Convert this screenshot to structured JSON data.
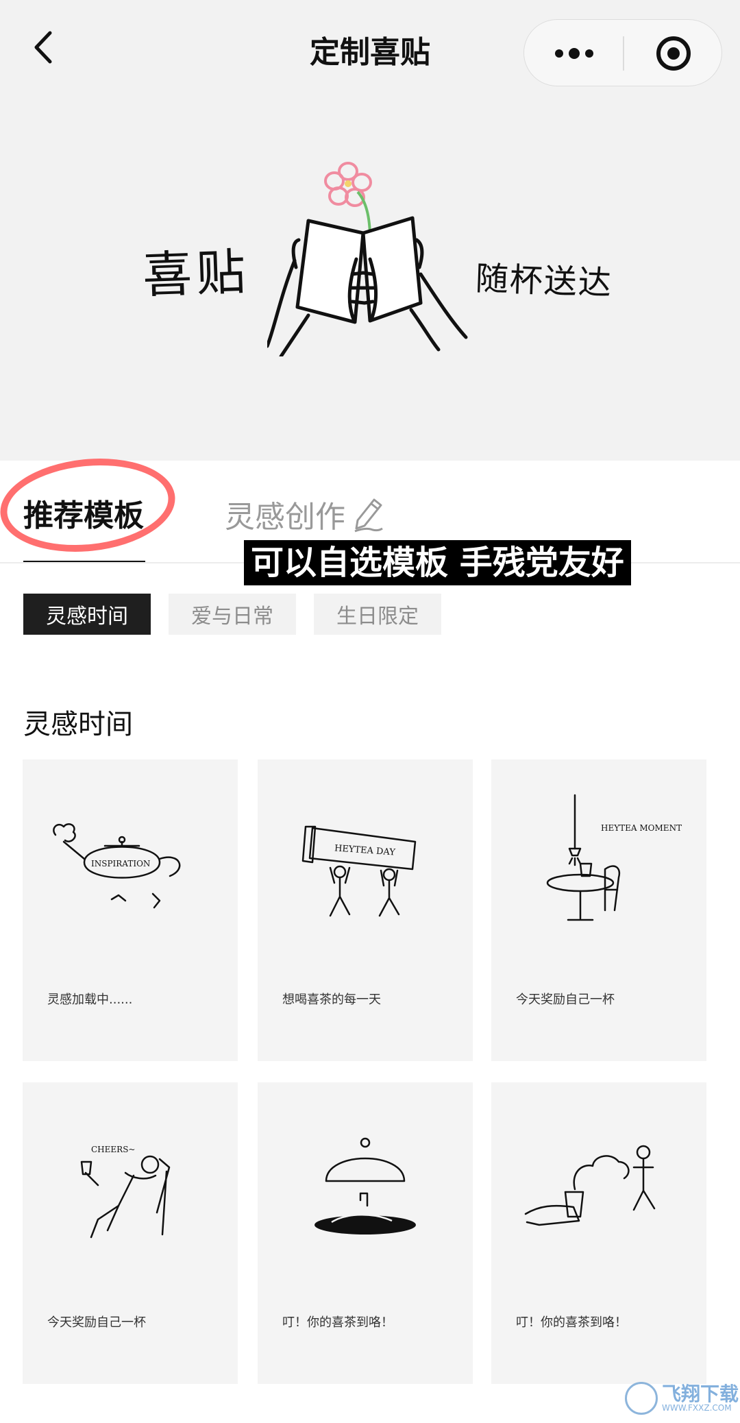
{
  "nav": {
    "title": "定制喜贴",
    "icons": {
      "back": "back-chevron-icon",
      "more": "more-dots-icon",
      "close": "target-circle-icon"
    }
  },
  "hero": {
    "left_text": "喜贴",
    "right_text": "随杯送达"
  },
  "tabs": {
    "recommended": "推荐模板",
    "inspiration": "灵感创作",
    "inspiration_icon": "pencil-icon"
  },
  "caption": "可以自选模板 手残党友好",
  "chips": [
    {
      "label": "灵感时间",
      "active": true
    },
    {
      "label": "爱与日常",
      "active": false
    },
    {
      "label": "生日限定",
      "active": false
    }
  ],
  "section_title": "灵感时间",
  "cards": [
    {
      "label": "灵感加载中......",
      "art_text": "INSPIRATION",
      "illustration": "teapot"
    },
    {
      "label": "想喝喜茶的每一天",
      "art_text": "HEYTEA DAY",
      "illustration": "cup-carriers"
    },
    {
      "label": "今天奖励自己一杯",
      "art_text": "HEYTEA MOMENT",
      "illustration": "table-lamp"
    },
    {
      "label": "今天奖励自己一杯",
      "art_text": "CHEERS~",
      "illustration": "lounging-man"
    },
    {
      "label": "叮！你的喜茶到咯！",
      "art_text": "",
      "illustration": "cloche"
    },
    {
      "label": "叮！你的喜茶到咯！",
      "art_text": "",
      "illustration": "hand-cup"
    }
  ],
  "watermark": {
    "main": "飞翔下载",
    "sub": "WWW.FXXZ.COM"
  },
  "colors": {
    "annotation": "#ff6f6f",
    "chip_active": "#1f1f1f",
    "banner_bg": "#f2f2f2",
    "flower": "#f08ca0",
    "stem": "#6cbf6a"
  }
}
